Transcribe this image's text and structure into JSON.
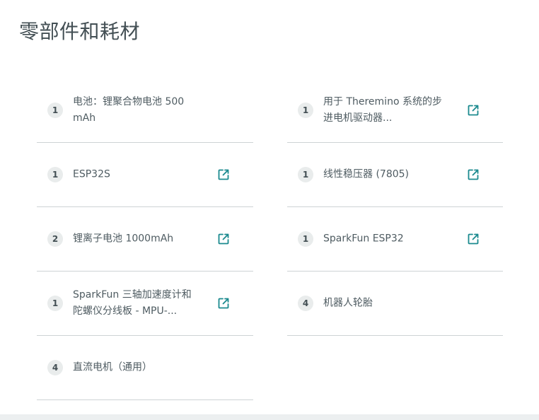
{
  "section": {
    "title": "零部件和耗材"
  },
  "parts": [
    {
      "qty": "1",
      "name": "电池：锂聚合物电池 500 mAh",
      "has_link": false
    },
    {
      "qty": "1",
      "name": "用于 Theremino 系统的步进电机驱动器...",
      "has_link": true
    },
    {
      "qty": "1",
      "name": "ESP32S",
      "has_link": true
    },
    {
      "qty": "1",
      "name": "线性稳压器 (7805)",
      "has_link": true
    },
    {
      "qty": "2",
      "name": "锂离子电池 1000mAh",
      "has_link": true
    },
    {
      "qty": "1",
      "name": "SparkFun ESP32",
      "has_link": true
    },
    {
      "qty": "1",
      "name": "SparkFun 三轴加速度计和陀螺仪分线板 - MPU-...",
      "has_link": true
    },
    {
      "qty": "4",
      "name": "机器人轮胎",
      "has_link": false
    },
    {
      "qty": "4",
      "name": "直流电机（通用）",
      "has_link": false
    }
  ],
  "colors": {
    "link_icon": "#1b8a8f",
    "divider": "#cdd3d5",
    "qty_badge_bg": "#e9ecec"
  },
  "icons": {
    "external_link": "external-link-icon"
  }
}
